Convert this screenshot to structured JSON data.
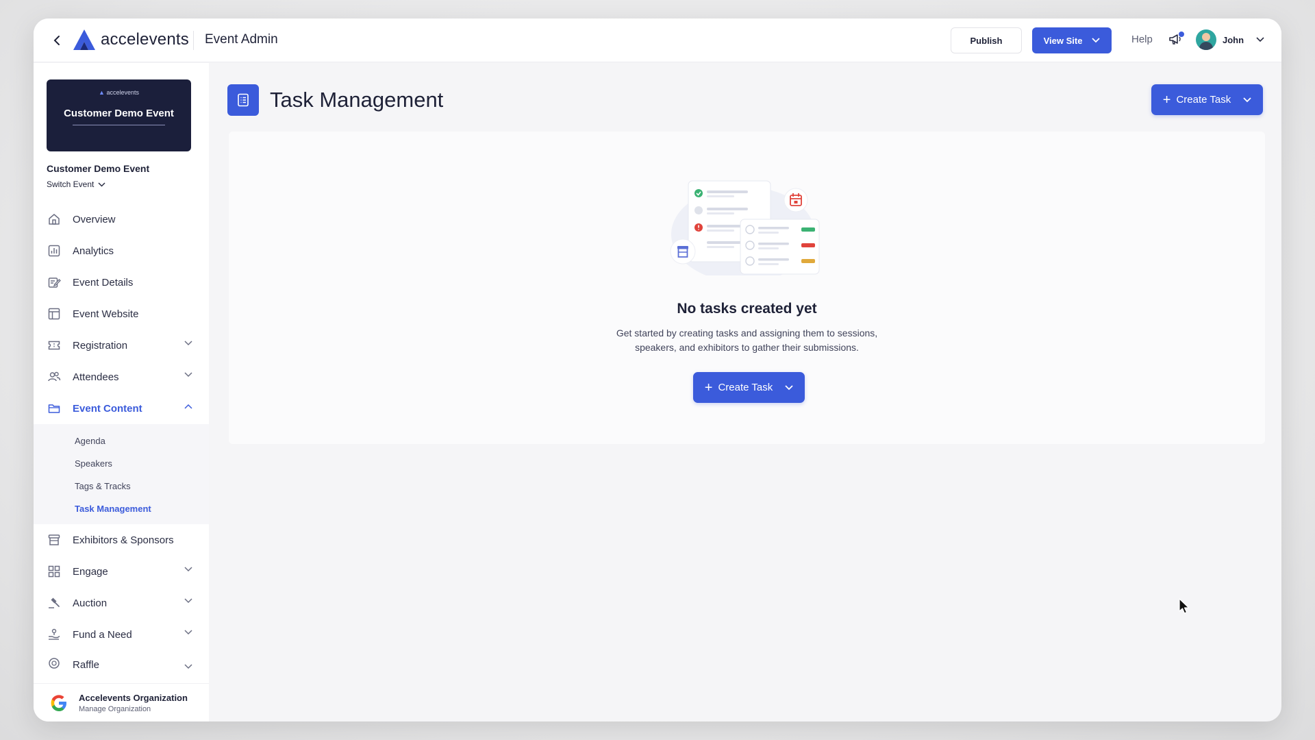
{
  "topbar": {
    "brand": "accelevents",
    "title": "Event Admin",
    "publish_label": "Publish",
    "view_site_label": "View Site",
    "help_label": "Help",
    "user_name": "John"
  },
  "sidebar": {
    "event_card": {
      "brand": "accelevents",
      "title": "Customer Demo Event"
    },
    "event_name": "Customer Demo Event",
    "switch_event": "Switch Event",
    "items": [
      {
        "label": "Overview",
        "icon": "home-icon"
      },
      {
        "label": "Analytics",
        "icon": "analytics-icon"
      },
      {
        "label": "Event Details",
        "icon": "edit-icon"
      },
      {
        "label": "Event Website",
        "icon": "layout-icon"
      },
      {
        "label": "Registration",
        "icon": "ticket-icon",
        "expandable": true
      },
      {
        "label": "Attendees",
        "icon": "people-icon",
        "expandable": true
      },
      {
        "label": "Event Content",
        "icon": "folder-icon",
        "expandable": true,
        "expanded": true,
        "active": true
      },
      {
        "label": "Exhibitors & Sponsors",
        "icon": "booth-icon"
      },
      {
        "label": "Engage",
        "icon": "grid-icon",
        "expandable": true
      },
      {
        "label": "Auction",
        "icon": "gavel-icon",
        "expandable": true
      },
      {
        "label": "Fund a Need",
        "icon": "donation-icon",
        "expandable": true
      },
      {
        "label": "Raffle",
        "icon": "raffle-icon",
        "expandable": true
      }
    ],
    "submenu": [
      {
        "label": "Agenda"
      },
      {
        "label": "Speakers"
      },
      {
        "label": "Tags & Tracks"
      },
      {
        "label": "Task Management",
        "active": true
      }
    ],
    "org": {
      "name": "Accelevents Organization",
      "sub": "Manage Organization"
    }
  },
  "main": {
    "page_title": "Task Management",
    "create_task_label": "Create Task",
    "empty_title": "No tasks created yet",
    "empty_desc_line1": "Get started by creating tasks and assigning them to sessions,",
    "empty_desc_line2": "speakers, and exhibitors to gather their submissions.",
    "empty_create_label": "Create Task"
  },
  "colors": {
    "accent": "#3b5bdb",
    "sidebar_card": "#1b1f3b",
    "text": "#1e2137"
  }
}
